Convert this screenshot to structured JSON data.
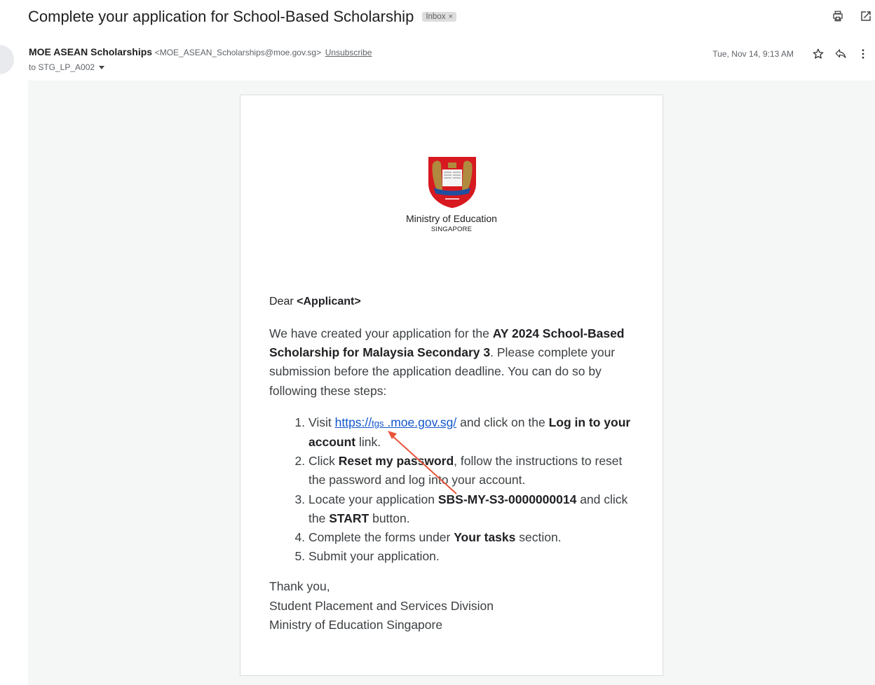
{
  "email": {
    "subject": "Complete your application for School-Based Scholarship",
    "label_chip": "Inbox",
    "label_chip_close": "×",
    "sender_name": "MOE ASEAN Scholarships",
    "sender_email": "<MOE_ASEAN_Scholarships@moe.gov.sg>",
    "unsubscribe": "Unsubscribe",
    "to": "to STG_LP_A002",
    "date": "Tue, Nov 14, 9:13 AM"
  },
  "icons": {
    "print": "print-icon",
    "open_new": "open-in-new-window-icon",
    "star": "star-icon",
    "reply": "reply-icon",
    "more": "more-vert-icon"
  },
  "letter": {
    "org_name": "Ministry of Education",
    "org_sub": "SINGAPORE",
    "greeting_prefix": "Dear",
    "greeting_name": "<Applicant>",
    "para_intro_1": "We have created your application for the ",
    "para_intro_bold": "AY 2024 School-Based Scholarship for Malaysia Secondary 3",
    "para_intro_2": ". Please complete your submission before the application deadline. You can do so by following these steps:",
    "step1_prefix": "Visit ",
    "step1_link_a": "https://",
    "step1_link_mid": "tgs",
    "step1_link_b": ".moe.gov.sg/",
    "step1_mid": " and click on the ",
    "step1_bold": "Log in to your account",
    "step1_suffix": " link.",
    "step2_prefix": "Click ",
    "step2_bold": "Reset my password",
    "step2_suffix": ", follow the instructions to reset the password and log into your account.",
    "step3_prefix": "Locate your application ",
    "step3_bold": "SBS-MY-S3-0000000014",
    "step3_mid": " and click the ",
    "step3_bold2": "START",
    "step3_suffix": " button.",
    "step4_prefix": "Complete the forms under ",
    "step4_bold": "Your tasks",
    "step4_suffix": " section.",
    "step5": "Submit your application.",
    "signoff_1": "Thank you,",
    "signoff_2": "Student Placement and Services Division",
    "signoff_3": "Ministry of Education Singapore"
  },
  "colors": {
    "link": "#1155cc",
    "annotation_arrow": "#e8533a",
    "crest_red": "#d71920"
  }
}
